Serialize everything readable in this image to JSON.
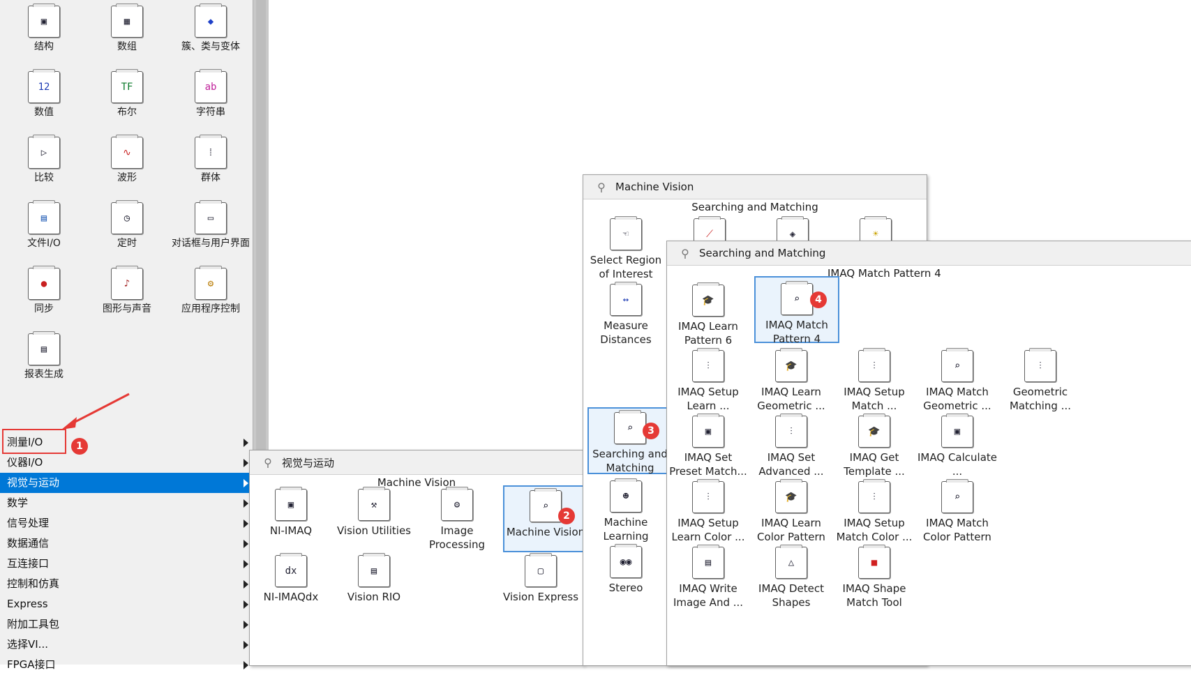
{
  "palette": {
    "items": [
      {
        "label": "结构",
        "icon": "structure-icon"
      },
      {
        "label": "数组",
        "icon": "array-icon"
      },
      {
        "label": "簇、类与变体",
        "icon": "cluster-icon"
      },
      {
        "label": "数值",
        "icon": "numeric-icon"
      },
      {
        "label": "布尔",
        "icon": "boolean-icon"
      },
      {
        "label": "字符串",
        "icon": "string-icon"
      },
      {
        "label": "比较",
        "icon": "comparison-icon"
      },
      {
        "label": "波形",
        "icon": "waveform-icon"
      },
      {
        "label": "群体",
        "icon": "group-icon"
      },
      {
        "label": "文件I/O",
        "icon": "file-io-icon"
      },
      {
        "label": "定时",
        "icon": "timing-icon"
      },
      {
        "label": "对话框与用户界面",
        "icon": "dialog-icon"
      },
      {
        "label": "同步",
        "icon": "sync-icon"
      },
      {
        "label": "图形与声音",
        "icon": "graphics-sound-icon"
      },
      {
        "label": "应用程序控制",
        "icon": "app-control-icon"
      },
      {
        "label": "报表生成",
        "icon": "report-icon"
      }
    ],
    "menu": [
      {
        "label": "测量I/O"
      },
      {
        "label": "仪器I/O"
      },
      {
        "label": "视觉与运动",
        "selected": true
      },
      {
        "label": "数学"
      },
      {
        "label": "信号处理"
      },
      {
        "label": "数据通信"
      },
      {
        "label": "互连接口"
      },
      {
        "label": "控制和仿真"
      },
      {
        "label": "Express"
      },
      {
        "label": "附加工具包"
      },
      {
        "label": "选择VI..."
      },
      {
        "label": "FPGA接口"
      }
    ]
  },
  "vision_popup": {
    "title": "视觉与运动",
    "subtitle": "Machine Vision",
    "items": [
      {
        "label": "NI-IMAQ",
        "icon": "ni-imaq-icon"
      },
      {
        "label": "Vision Utilities",
        "icon": "vision-utilities-icon"
      },
      {
        "label": "Image Processing",
        "icon": "image-processing-icon"
      },
      {
        "label": "Machine Vision",
        "icon": "machine-vision-icon",
        "selected": true
      },
      {
        "label": "NI-IMAQdx",
        "icon": "ni-imaqdx-icon"
      },
      {
        "label": "Vision RIO",
        "icon": "vision-rio-icon"
      },
      {
        "label": "Vision Express",
        "icon": "vision-express-icon"
      }
    ]
  },
  "machine_vision_popup": {
    "title": "Machine Vision",
    "subtitle": "Searching and Matching",
    "items": [
      {
        "label": "Select Region of Interest",
        "icon": "roi-icon"
      },
      {
        "label": "Measure Distances",
        "icon": "measure-icon"
      },
      {
        "label": "Searching and Matching",
        "icon": "search-match-icon",
        "selected": true
      },
      {
        "label": "Machine Learning",
        "icon": "machine-learning-icon"
      },
      {
        "label": "Stereo",
        "icon": "stereo-icon"
      }
    ]
  },
  "search_popup": {
    "title": "Searching and Matching",
    "subtitle": "IMAQ Match Pattern 4",
    "items": [
      {
        "label": "IMAQ Learn Pattern 6",
        "icon": "learn-pattern-icon"
      },
      {
        "label": "IMAQ Match Pattern 4",
        "icon": "match-pattern-icon",
        "selected": true
      },
      {
        "label": "IMAQ Setup Learn ...",
        "icon": "setup-learn-icon"
      },
      {
        "label": "IMAQ Learn Geometric ...",
        "icon": "learn-geometric-icon"
      },
      {
        "label": "IMAQ Setup Match ...",
        "icon": "setup-match-icon"
      },
      {
        "label": "IMAQ Match Geometric ...",
        "icon": "match-geometric-icon"
      },
      {
        "label": "Geometric Matching ...",
        "icon": "geometric-matching-icon"
      },
      {
        "label": "IMAQ Set Preset Match...",
        "icon": "preset-match-icon"
      },
      {
        "label": "IMAQ Set Advanced ...",
        "icon": "set-advanced-icon"
      },
      {
        "label": "IMAQ Get Template ...",
        "icon": "get-template-icon"
      },
      {
        "label": "IMAQ Calculate ...",
        "icon": "calculate-icon"
      },
      {
        "label": "IMAQ Setup Learn Color ...",
        "icon": "setup-learn-color-icon"
      },
      {
        "label": "IMAQ Learn Color Pattern",
        "icon": "learn-color-icon"
      },
      {
        "label": "IMAQ Setup Match Color ...",
        "icon": "setup-match-color-icon"
      },
      {
        "label": "IMAQ Match Color Pattern",
        "icon": "match-color-icon"
      },
      {
        "label": "IMAQ Write Image And ...",
        "icon": "write-image-icon"
      },
      {
        "label": "IMAQ Detect Shapes",
        "icon": "detect-shapes-icon"
      },
      {
        "label": "IMAQ Shape Match Tool",
        "icon": "shape-match-icon"
      }
    ]
  },
  "markers": [
    "1",
    "2",
    "3",
    "4"
  ],
  "colors": {
    "selection": "#0078d7",
    "marker": "#e53935",
    "highlight_border": "#4a90d9"
  }
}
